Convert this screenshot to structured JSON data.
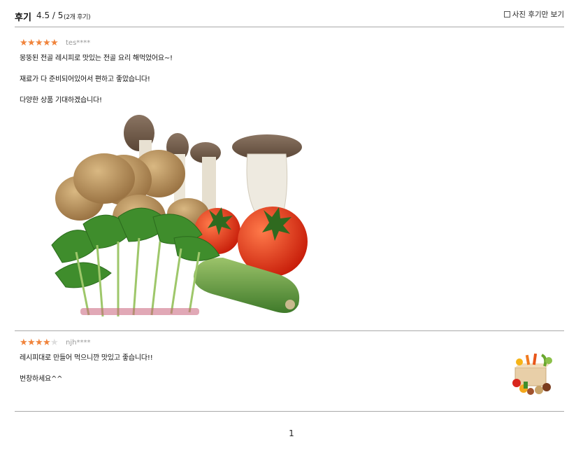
{
  "header": {
    "title": "후기",
    "score": "4.5 / 5",
    "count": "(2개 후기)",
    "photo_only_label": "사진 후기만 보기"
  },
  "reviews": [
    {
      "rating": 5,
      "user": "tes****",
      "lines": [
        "몽뚱된 전골 레시피로 맛있는 전골 요리 해먹었어요~!",
        "재료가 다 준비되어있어서 편하고 좋았습니다!",
        "다양한 상품 기대하겠습니다!"
      ],
      "photo_icon": "vegetables-photo"
    },
    {
      "rating": 4,
      "user": "njh****",
      "lines": [
        "레시피대로 만들어 먹으니깐 맛있고 좋습니다!!",
        "번창하세요^^"
      ],
      "photo_icon": "vegetable-box-thumbnail"
    }
  ],
  "pagination": {
    "current": "1"
  },
  "colors": {
    "star_on": "#f0843c",
    "star_off": "#dedede",
    "divider": "#a9a9a9"
  }
}
